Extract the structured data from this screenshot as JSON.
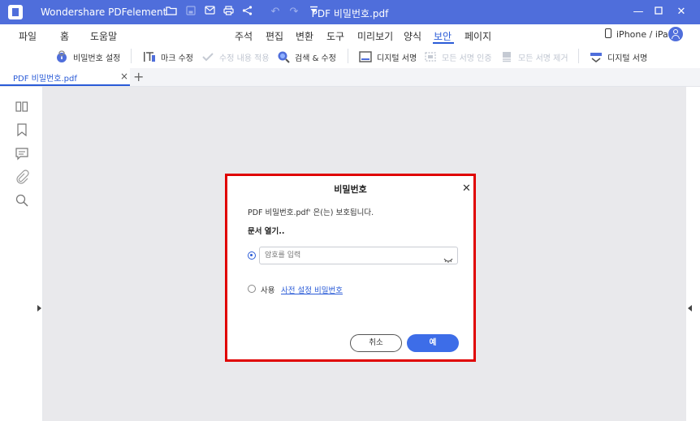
{
  "titlebar": {
    "app_name": "Wondershare PDFelement",
    "doc_title": "PDF 비밀번호.pdf"
  },
  "menu": {
    "items": [
      "파일",
      "홈",
      "도움말",
      "주석",
      "편집",
      "변환",
      "도구",
      "미리보기",
      "양식",
      "보안",
      "페이지"
    ],
    "active": "보안",
    "device_label": "iPhone / iPad"
  },
  "toolbar": {
    "password_settings": "비밀번호 설정",
    "mark_edit": "마크 수정",
    "apply_edit": "수정 내용 적용",
    "search_edit": "검색 & 수정",
    "digital_signature": "디지털 서명",
    "verify_all": "모든 서명 인증",
    "remove_all": "모든 서명 제거",
    "digital_sign": "디지털 서명"
  },
  "tabs": {
    "active_label": "PDF 비밀번호.pdf"
  },
  "dialog": {
    "title": "비밀번호",
    "message": "PDF 비밀번호.pdf' 은(는) 보호됩니다.",
    "subtitle": "문서 열기..",
    "password_placeholder": "암호를 입력",
    "use_label": "사용",
    "preset_link": "사전 설정 비밀번호",
    "cancel_label": "취소",
    "ok_label": "예"
  },
  "colors": {
    "titlebar": "#4f6edb",
    "accent": "#2a5bd7",
    "highlight_border": "#e00000"
  }
}
